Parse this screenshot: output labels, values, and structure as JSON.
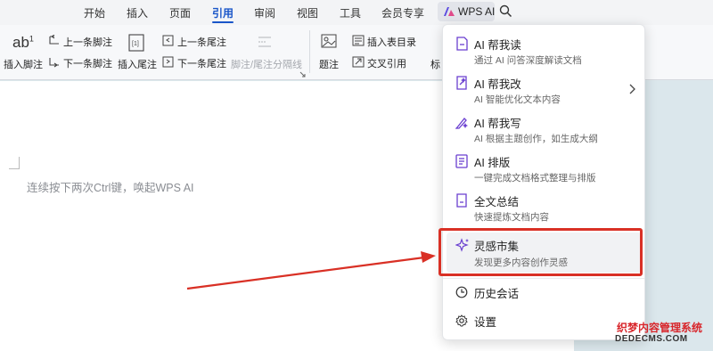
{
  "menubar": {
    "tabs": [
      {
        "label": "开始"
      },
      {
        "label": "插入"
      },
      {
        "label": "页面"
      },
      {
        "label": "引用"
      },
      {
        "label": "审阅"
      },
      {
        "label": "视图"
      },
      {
        "label": "工具"
      },
      {
        "label": "会员专享"
      }
    ],
    "active_tab": "引用",
    "wps_ai_label": "WPS AI"
  },
  "ribbon": {
    "insert_footnote": "插入脚注",
    "prev_footnote": "上一条脚注",
    "next_footnote": "下一条脚注",
    "insert_endnote": "插入尾注",
    "prev_endnote": "上一条尾注",
    "next_endnote": "下一条尾注",
    "separator_label": "脚注/尾注分隔线",
    "caption": "题注",
    "insert_table_of_figures": "插入表目录",
    "cross_reference": "交叉引用",
    "cut_label": "标",
    "footnote_icon_text": "ab",
    "footnote_icon_sup": "1"
  },
  "document": {
    "hint": "连续按下两次Ctrl键，唤起WPS AI"
  },
  "dropdown": {
    "items": [
      {
        "title": "AI 帮我读",
        "subtitle": "通过 AI 问答深度解读文档",
        "icon": "ai-read-icon"
      },
      {
        "title": "AI 帮我改",
        "subtitle": "AI 智能优化文本内容",
        "icon": "ai-edit-icon"
      },
      {
        "title": "AI 帮我写",
        "subtitle": "AI 根据主题创作，如生成大纲",
        "icon": "ai-write-icon"
      },
      {
        "title": "AI 排版",
        "subtitle": "一键完成文档格式整理与排版",
        "icon": "ai-layout-icon"
      },
      {
        "title": "全文总结",
        "subtitle": "快速提炼文档内容",
        "icon": "summary-icon"
      },
      {
        "title": "灵感市集",
        "subtitle": "发现更多内容创作灵感",
        "icon": "sparkle-icon"
      }
    ],
    "history": "历史会话",
    "settings": "设置"
  },
  "watermark": {
    "line1": "织梦内容管理系统",
    "line2": "DEDECMS.COM"
  },
  "colors": {
    "accent": "#1a56c9",
    "ai_purple": "#6a3fd0",
    "highlight_red": "#d93025"
  }
}
